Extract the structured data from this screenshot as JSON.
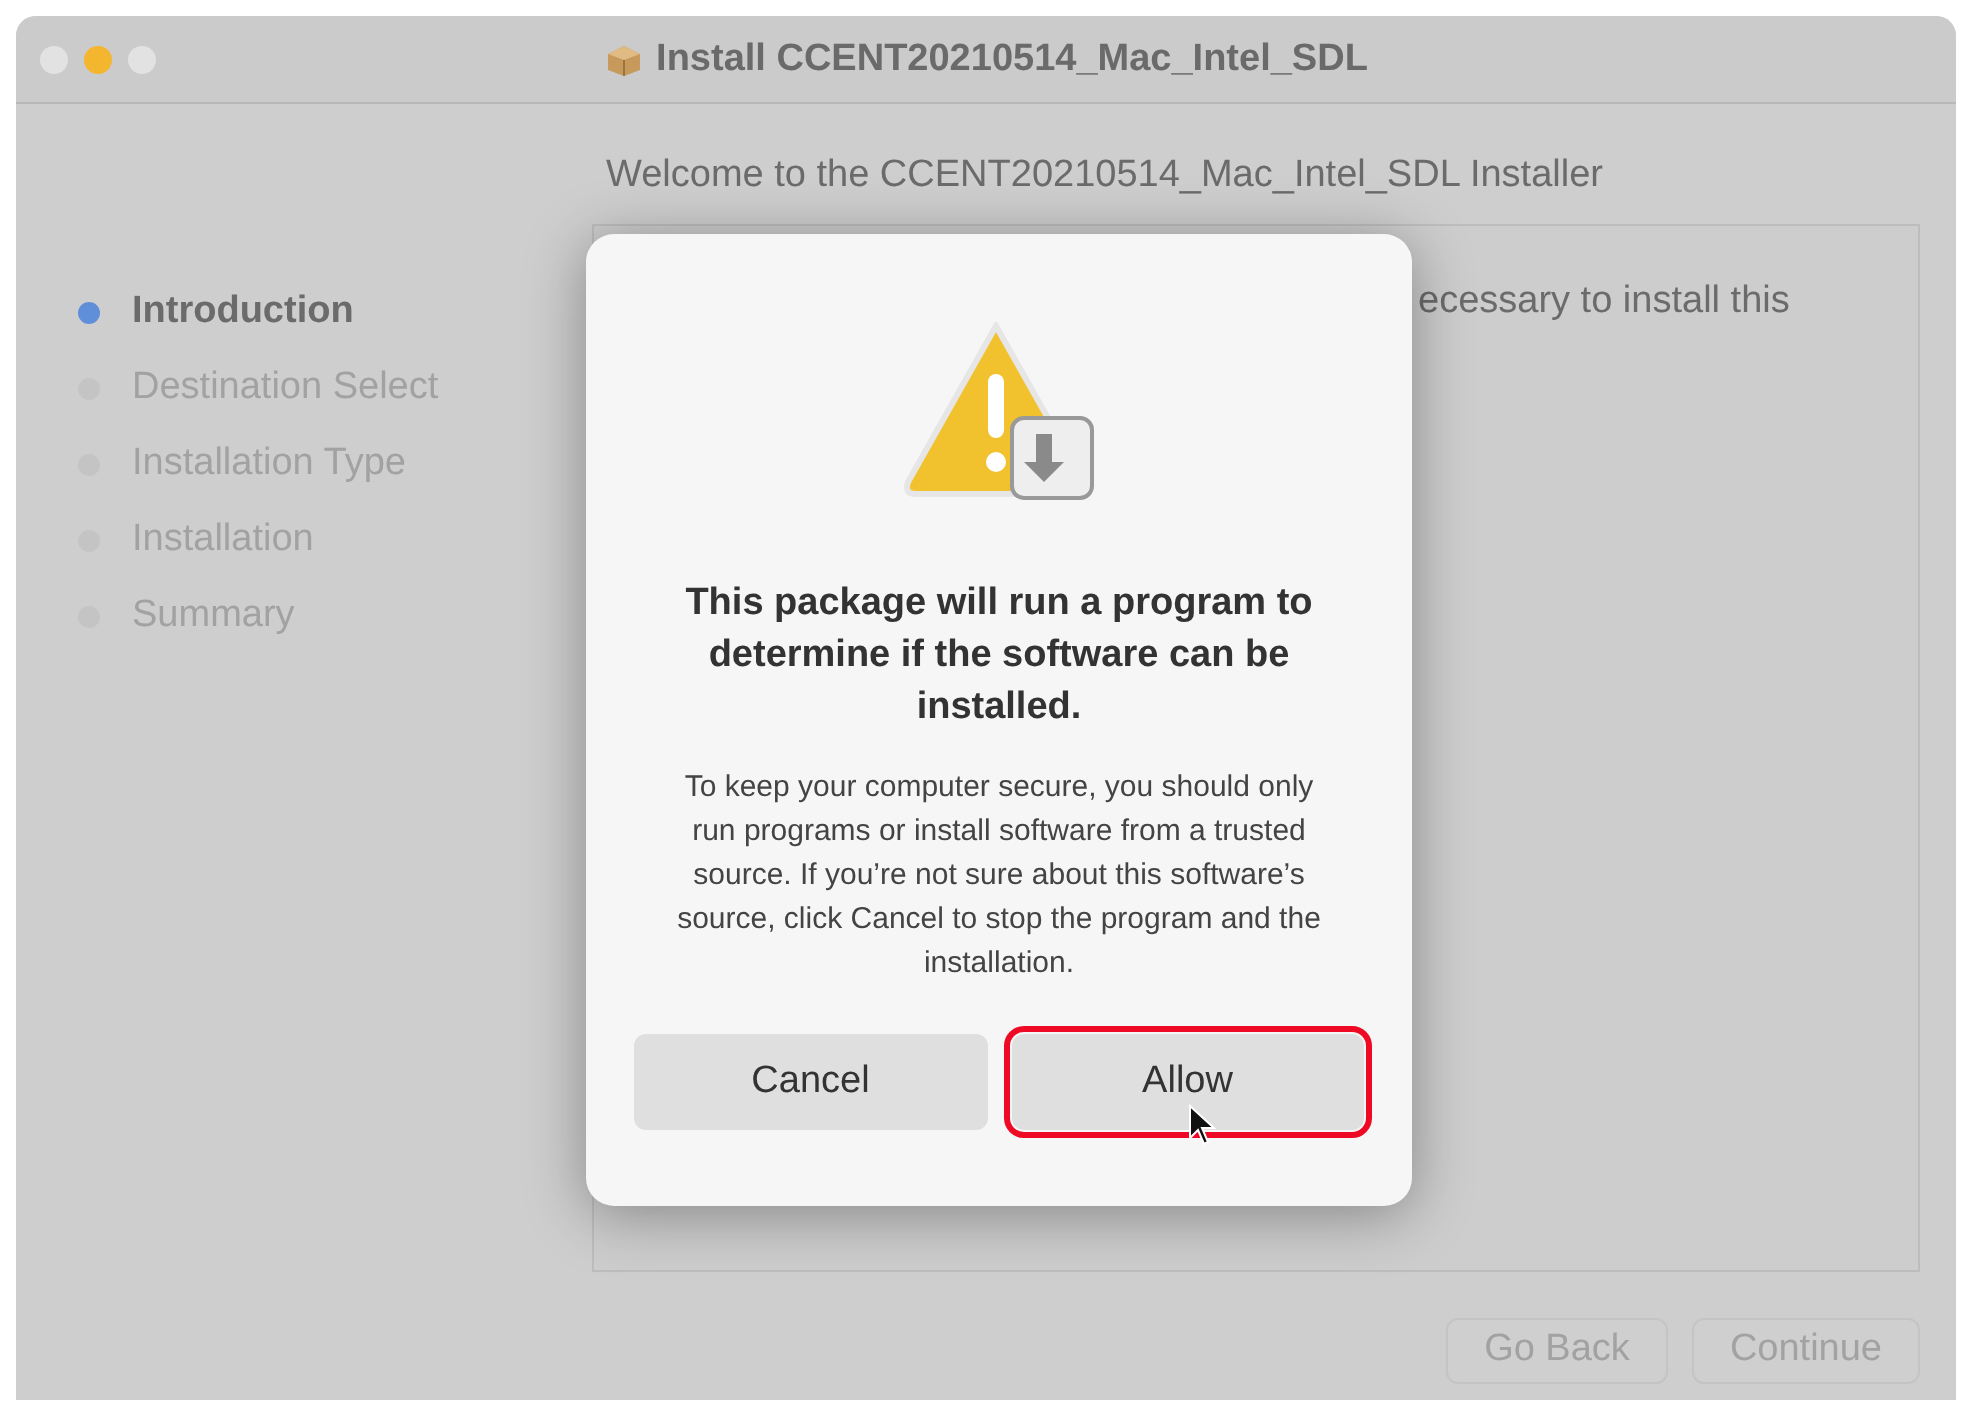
{
  "window": {
    "title": "Install CCENT20210514_Mac_Intel_SDL"
  },
  "steps": [
    {
      "label": "Introduction",
      "selected": true
    },
    {
      "label": "Destination Select",
      "selected": false
    },
    {
      "label": "Installation Type",
      "selected": false
    },
    {
      "label": "Installation",
      "selected": false
    },
    {
      "label": "Summary",
      "selected": false
    }
  ],
  "content": {
    "heading": "Welcome to the CCENT20210514_Mac_Intel_SDL Installer",
    "body_visible": "ecessary to install this"
  },
  "footer_buttons": [
    {
      "label": "Go Back",
      "disabled": true
    },
    {
      "label": "Continue",
      "disabled": true
    }
  ],
  "dialog": {
    "title": "This package will run a program to determine if the software can be installed.",
    "message": "To keep your computer secure, you should only run programs or install software from a trusted source. If you’re not sure about this software’s source, click Cancel to stop the program and the installation.",
    "buttons": [
      {
        "label": "Cancel",
        "highlighted": false
      },
      {
        "label": "Allow",
        "highlighted": true
      }
    ]
  }
}
